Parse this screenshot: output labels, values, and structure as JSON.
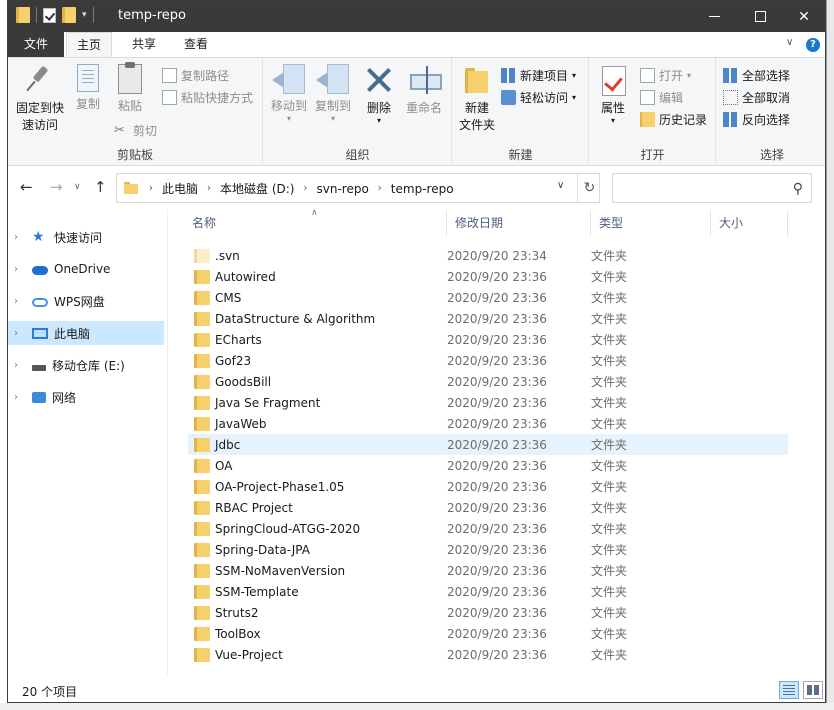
{
  "window": {
    "title": "temp-repo"
  },
  "ribbon_tabs": {
    "file": "文件",
    "home": "主页",
    "share": "共享",
    "view": "查看"
  },
  "ribbon": {
    "clipboard": {
      "label": "剪贴板",
      "pin": "固定到快速访问",
      "pin_line1": "固定到快",
      "pin_line2": "速访问",
      "copy": "复制",
      "paste": "粘贴",
      "copy_path": "复制路径",
      "paste_shortcut": "粘贴快捷方式",
      "cut": "剪切"
    },
    "organize": {
      "label": "组织",
      "move_to": "移动到",
      "copy_to": "复制到",
      "delete": "删除",
      "rename": "重命名"
    },
    "new": {
      "label": "新建",
      "new_folder_line1": "新建",
      "new_folder_line2": "文件夹",
      "new_item": "新建项目",
      "easy_access": "轻松访问"
    },
    "open": {
      "label": "打开",
      "properties": "属性",
      "open": "打开",
      "edit": "编辑",
      "history": "历史记录"
    },
    "select": {
      "label": "选择",
      "select_all": "全部选择",
      "select_none": "全部取消",
      "invert": "反向选择"
    }
  },
  "address": {
    "crumbs": [
      "此电脑",
      "本地磁盘 (D:)",
      "svn-repo",
      "temp-repo"
    ],
    "search_placeholder": ""
  },
  "nav_pane": [
    {
      "label": "快速访问",
      "icon": "star-icon",
      "selected": false
    },
    {
      "label": "OneDrive",
      "icon": "cloud-icon",
      "selected": false
    },
    {
      "label": "WPS网盘",
      "icon": "wps-cloud-icon",
      "selected": false
    },
    {
      "label": "此电脑",
      "icon": "pc-icon",
      "selected": true
    },
    {
      "label": "移动仓库 (E:)",
      "icon": "drive-icon",
      "selected": false
    },
    {
      "label": "网络",
      "icon": "network-icon",
      "selected": false
    }
  ],
  "columns": {
    "name": "名称",
    "date": "修改日期",
    "type": "类型",
    "size": "大小"
  },
  "files": [
    {
      "name": ".svn",
      "date": "2020/9/20 23:34",
      "type": "文件夹"
    },
    {
      "name": "Autowired",
      "date": "2020/9/20 23:36",
      "type": "文件夹"
    },
    {
      "name": "CMS",
      "date": "2020/9/20 23:36",
      "type": "文件夹"
    },
    {
      "name": "DataStructure & Algorithm",
      "date": "2020/9/20 23:36",
      "type": "文件夹"
    },
    {
      "name": "ECharts",
      "date": "2020/9/20 23:36",
      "type": "文件夹"
    },
    {
      "name": "Gof23",
      "date": "2020/9/20 23:36",
      "type": "文件夹"
    },
    {
      "name": "GoodsBill",
      "date": "2020/9/20 23:36",
      "type": "文件夹"
    },
    {
      "name": "Java Se Fragment",
      "date": "2020/9/20 23:36",
      "type": "文件夹"
    },
    {
      "name": "JavaWeb",
      "date": "2020/9/20 23:36",
      "type": "文件夹"
    },
    {
      "name": "Jdbc",
      "date": "2020/9/20 23:36",
      "type": "文件夹"
    },
    {
      "name": "OA",
      "date": "2020/9/20 23:36",
      "type": "文件夹"
    },
    {
      "name": "OA-Project-Phase1.05",
      "date": "2020/9/20 23:36",
      "type": "文件夹"
    },
    {
      "name": "RBAC Project",
      "date": "2020/9/20 23:36",
      "type": "文件夹"
    },
    {
      "name": "SpringCloud-ATGG-2020",
      "date": "2020/9/20 23:36",
      "type": "文件夹"
    },
    {
      "name": "Spring-Data-JPA",
      "date": "2020/9/20 23:36",
      "type": "文件夹"
    },
    {
      "name": "SSM-NoMavenVersion",
      "date": "2020/9/20 23:36",
      "type": "文件夹"
    },
    {
      "name": "SSM-Template",
      "date": "2020/9/20 23:36",
      "type": "文件夹"
    },
    {
      "name": "Struts2",
      "date": "2020/9/20 23:36",
      "type": "文件夹"
    },
    {
      "name": "ToolBox",
      "date": "2020/9/20 23:36",
      "type": "文件夹"
    },
    {
      "name": "Vue-Project",
      "date": "2020/9/20 23:36",
      "type": "文件夹"
    }
  ],
  "hovered_file": "Jdbc",
  "status": {
    "count": "20 个项目"
  },
  "colors": {
    "titlebar": "#3a3a3a",
    "ribbon": "#f5f6f7",
    "selection": "#cce8ff",
    "hover": "#e5f3ff",
    "folder": "#f6d06a"
  }
}
